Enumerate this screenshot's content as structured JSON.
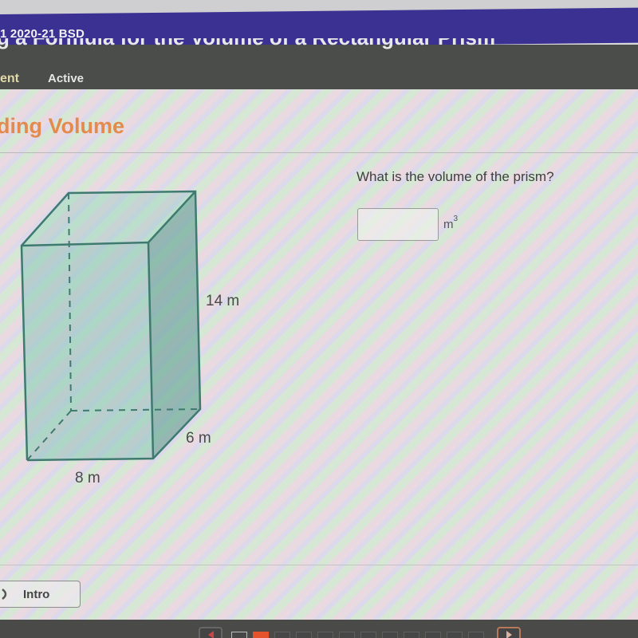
{
  "header": {
    "course_title": "1 2020-21 BSD",
    "lesson_title": "g a Formula for the Volume of a Rectangular Prism",
    "tabs": [
      {
        "label": "ent",
        "state": "current"
      },
      {
        "label": "Active",
        "state": "normal"
      }
    ]
  },
  "section": {
    "title": "ding Volume"
  },
  "question": {
    "prompt": "What is the volume of the prism?",
    "answer_value": "",
    "answer_placeholder": "",
    "unit_base": "m",
    "unit_exponent": "3"
  },
  "figure": {
    "shape": "rectangular prism",
    "dimensions": {
      "height": "14 m",
      "depth": "6 m",
      "width": "8 m"
    },
    "colors": {
      "edge": "#3e7a70",
      "front_fill": "#7fc2b4",
      "side_fill": "#5d9e92"
    }
  },
  "footer": {
    "intro_label": "Intro",
    "pager": {
      "total_pages": 12,
      "current_page": 2,
      "visited_pages": [
        1
      ]
    }
  },
  "colors": {
    "course_bar": "#3b3192",
    "lesson_bar": "#4a4d49",
    "section_title": "#e38a4e",
    "pager_current": "#e5532c"
  }
}
